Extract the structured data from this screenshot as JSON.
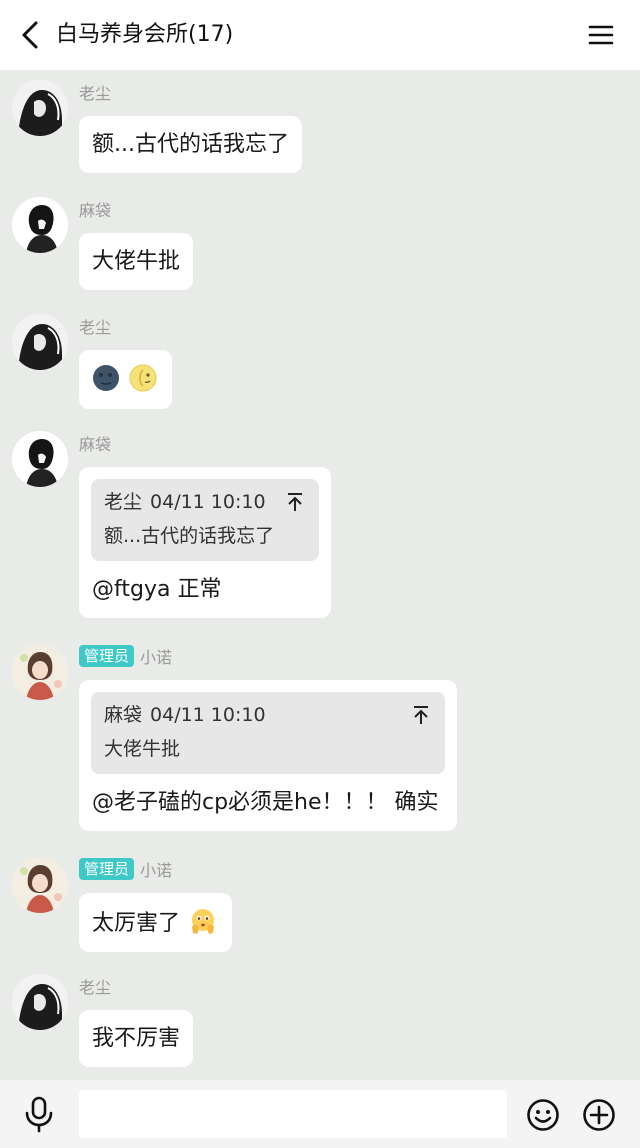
{
  "header": {
    "title": "白马养身会所(17)"
  },
  "messages": [
    {
      "sender": "老尘",
      "text": "额...古代的话我忘了"
    },
    {
      "sender": "麻袋",
      "text": "大佬牛批"
    },
    {
      "sender": "老尘",
      "emojis": [
        "new-moon-face",
        "first-quarter-moon-face"
      ]
    },
    {
      "sender": "麻袋",
      "quote": {
        "author": "老尘",
        "time": "04/11 10:10",
        "text": "额...古代的话我忘了"
      },
      "text": "@ftgya 正常"
    },
    {
      "sender": "小诺",
      "badge": "管理员",
      "quote": {
        "author": "麻袋",
        "time": "04/11 10:10",
        "text": "大佬牛批"
      },
      "text": "@老子磕的cp必须是he！！！ 确实"
    },
    {
      "sender": "小诺",
      "badge": "管理员",
      "text": "太厉害了",
      "emojis": [
        "pleading-hands-emoji"
      ]
    },
    {
      "sender": "老尘",
      "text": "我不厉害"
    }
  ],
  "input": {
    "value": "",
    "placeholder": ""
  },
  "colors": {
    "chat_background": "#e8ebe7",
    "bubble": "#ffffff",
    "admin_badge": "#3fc9c6",
    "quote_background": "#e7e7e7"
  }
}
